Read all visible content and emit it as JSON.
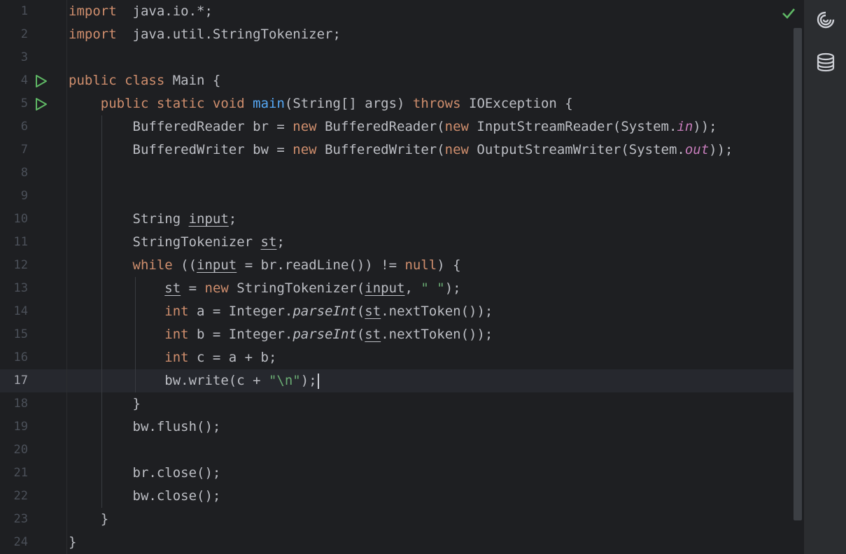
{
  "editor": {
    "language": "java",
    "current_line": 17,
    "lines": [
      {
        "n": "1",
        "tokens": [
          [
            "kw",
            "import"
          ],
          [
            "",
            "  java.io.*;"
          ]
        ]
      },
      {
        "n": "2",
        "tokens": [
          [
            "kw",
            "import"
          ],
          [
            "",
            "  java.util.StringTokenizer;"
          ]
        ]
      },
      {
        "n": "3",
        "tokens": []
      },
      {
        "n": "4",
        "run": true,
        "tokens": [
          [
            "kw",
            "public class"
          ],
          [
            "",
            " Main {"
          ]
        ]
      },
      {
        "n": "5",
        "run": true,
        "tokens": [
          [
            "",
            "    "
          ],
          [
            "kw",
            "public static void"
          ],
          [
            "",
            " "
          ],
          [
            "fn",
            "main"
          ],
          [
            "",
            "(String[] args) "
          ],
          [
            "kw",
            "throws"
          ],
          [
            "",
            " IOException {"
          ]
        ]
      },
      {
        "n": "6",
        "tokens": [
          [
            "",
            "        BufferedReader br = "
          ],
          [
            "kw",
            "new"
          ],
          [
            "",
            " BufferedReader("
          ],
          [
            "kw",
            "new"
          ],
          [
            "",
            " InputStreamReader(System."
          ],
          [
            "static",
            "in"
          ],
          [
            "",
            "));"
          ]
        ]
      },
      {
        "n": "7",
        "tokens": [
          [
            "",
            "        BufferedWriter bw = "
          ],
          [
            "kw",
            "new"
          ],
          [
            "",
            " BufferedWriter("
          ],
          [
            "kw",
            "new"
          ],
          [
            "",
            " OutputStreamWriter(System."
          ],
          [
            "static",
            "out"
          ],
          [
            "",
            "));"
          ]
        ]
      },
      {
        "n": "8",
        "tokens": []
      },
      {
        "n": "9",
        "tokens": []
      },
      {
        "n": "10",
        "tokens": [
          [
            "",
            "        String "
          ],
          [
            "ul",
            "input"
          ],
          [
            "",
            ";"
          ]
        ]
      },
      {
        "n": "11",
        "tokens": [
          [
            "",
            "        StringTokenizer "
          ],
          [
            "ul",
            "st"
          ],
          [
            "",
            ";"
          ]
        ]
      },
      {
        "n": "12",
        "tokens": [
          [
            "",
            "        "
          ],
          [
            "kw",
            "while"
          ],
          [
            "",
            " (("
          ],
          [
            "ul",
            "input"
          ],
          [
            "",
            " = br.readLine()) != "
          ],
          [
            "kw",
            "null"
          ],
          [
            "",
            ") {"
          ]
        ]
      },
      {
        "n": "13",
        "tokens": [
          [
            "",
            "            "
          ],
          [
            "ul",
            "st"
          ],
          [
            "",
            " = "
          ],
          [
            "kw",
            "new"
          ],
          [
            "",
            " StringTokenizer("
          ],
          [
            "ul",
            "input"
          ],
          [
            "",
            ", "
          ],
          [
            "str",
            "\" \""
          ],
          [
            "",
            ");"
          ]
        ]
      },
      {
        "n": "14",
        "tokens": [
          [
            "",
            "            "
          ],
          [
            "kw",
            "int"
          ],
          [
            "",
            " a = Integer."
          ],
          [
            "italic",
            "parseInt"
          ],
          [
            "",
            "("
          ],
          [
            "ul",
            "st"
          ],
          [
            "",
            ".nextToken());"
          ]
        ]
      },
      {
        "n": "15",
        "tokens": [
          [
            "",
            "            "
          ],
          [
            "kw",
            "int"
          ],
          [
            "",
            " b = Integer."
          ],
          [
            "italic",
            "parseInt"
          ],
          [
            "",
            "("
          ],
          [
            "ul",
            "st"
          ],
          [
            "",
            ".nextToken());"
          ]
        ]
      },
      {
        "n": "16",
        "tokens": [
          [
            "",
            "            "
          ],
          [
            "kw",
            "int"
          ],
          [
            "",
            " c = a + b;"
          ]
        ]
      },
      {
        "n": "17",
        "caret": true,
        "tokens": [
          [
            "",
            "            bw.write(c + "
          ],
          [
            "str",
            "\"\\n\""
          ],
          [
            "",
            ");"
          ]
        ]
      },
      {
        "n": "18",
        "tokens": [
          [
            "",
            "        }"
          ]
        ]
      },
      {
        "n": "19",
        "tokens": [
          [
            "",
            "        bw.flush();"
          ]
        ]
      },
      {
        "n": "20",
        "tokens": []
      },
      {
        "n": "21",
        "tokens": [
          [
            "",
            "        br.close();"
          ]
        ]
      },
      {
        "n": "22",
        "tokens": [
          [
            "",
            "        bw.close();"
          ]
        ]
      },
      {
        "n": "23",
        "tokens": [
          [
            "",
            "    }"
          ]
        ]
      },
      {
        "n": "24",
        "tokens": [
          [
            "",
            "}"
          ]
        ]
      }
    ]
  },
  "status": {
    "inspection_icon": "checkmark-icon",
    "color": "#5fb865"
  },
  "right_toolbar": [
    {
      "name": "ai-assistant-icon"
    },
    {
      "name": "database-icon"
    }
  ],
  "colors": {
    "background": "#1e1f22",
    "keyword": "#cf8e6d",
    "function": "#56a8f5",
    "string": "#6aab73",
    "static_field": "#c77dbb",
    "run_icon": "#5fb865"
  }
}
